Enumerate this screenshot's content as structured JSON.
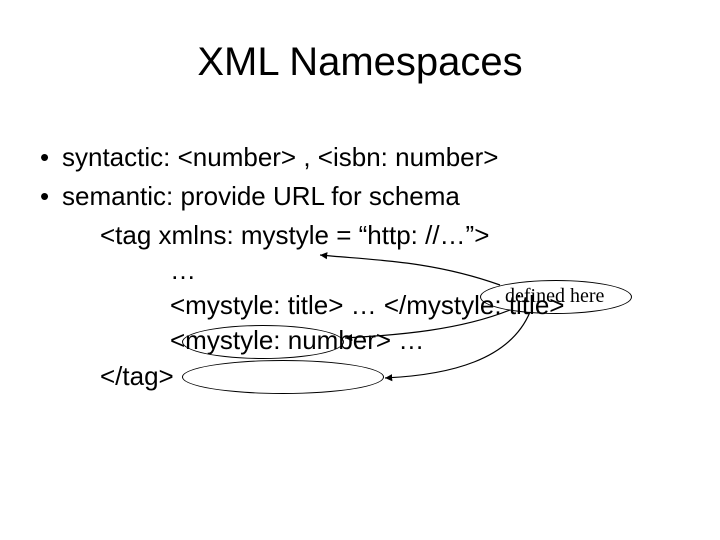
{
  "title": "XML Namespaces",
  "bullets": {
    "b1": "syntactic: <number> , <isbn: number>",
    "b2": "semantic: provide URL for schema"
  },
  "code": {
    "line1": "<tag  xmlns: mystyle = “http: //…”>",
    "line2": "…",
    "line3_open": "<mystyle: title>",
    "line3_mid": " … ",
    "line3_close": "</mystyle: title>",
    "line4": "<mystyle: number> …",
    "line5": "</tag>"
  },
  "callout": {
    "defined_here": "defined here"
  },
  "glyphs": {
    "bullet_dot": "•"
  }
}
